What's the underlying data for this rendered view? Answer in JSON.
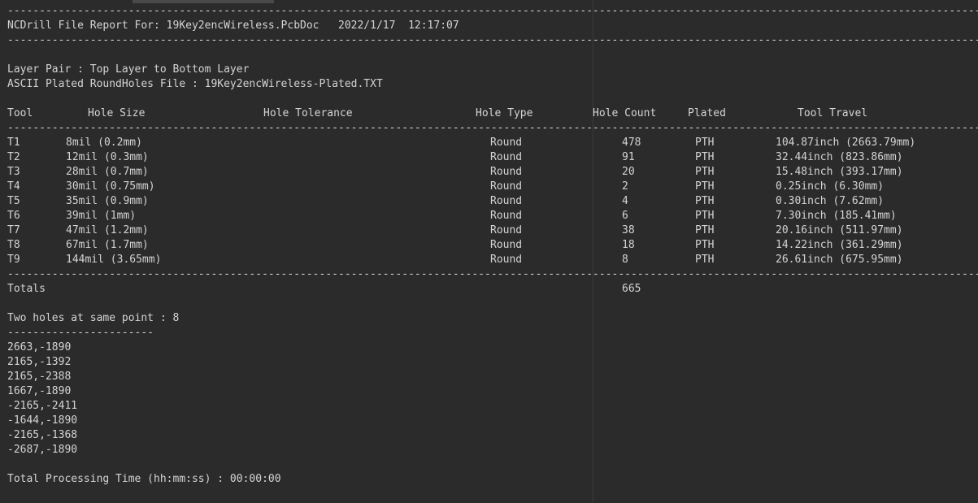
{
  "report": {
    "rule_long": "--------------------------------------------------------------------------------------------------------------------------------------------------------------------------------------",
    "header": "NCDrill File Report For: 19Key2encWireless.PcbDoc   2022/1/17  12:17:07",
    "layer_pair": "Layer Pair : Top Layer to Bottom Layer",
    "file_line": "ASCII Plated RoundHoles File : 19Key2encWireless-Plated.TXT",
    "columns": {
      "tool": "Tool",
      "hole_size": "Hole Size",
      "hole_tolerance": "Hole Tolerance",
      "hole_type": "Hole Type",
      "hole_count": "Hole Count",
      "plated": "Plated",
      "tool_travel": "Tool Travel"
    },
    "tools": [
      {
        "tool": "T1",
        "size": "8mil (0.2mm)",
        "type": "Round",
        "count": "478",
        "plated": "PTH",
        "travel": "104.87inch (2663.79mm)"
      },
      {
        "tool": "T2",
        "size": "12mil (0.3mm)",
        "type": "Round",
        "count": "91",
        "plated": "PTH",
        "travel": "32.44inch (823.86mm)"
      },
      {
        "tool": "T3",
        "size": "28mil (0.7mm)",
        "type": "Round",
        "count": "20",
        "plated": "PTH",
        "travel": "15.48inch (393.17mm)"
      },
      {
        "tool": "T4",
        "size": "30mil (0.75mm)",
        "type": "Round",
        "count": "2",
        "plated": "PTH",
        "travel": "0.25inch (6.30mm)"
      },
      {
        "tool": "T5",
        "size": "35mil (0.9mm)",
        "type": "Round",
        "count": "4",
        "plated": "PTH",
        "travel": "0.30inch (7.62mm)"
      },
      {
        "tool": "T6",
        "size": "39mil (1mm)",
        "type": "Round",
        "count": "6",
        "plated": "PTH",
        "travel": "7.30inch (185.41mm)"
      },
      {
        "tool": "T7",
        "size": "47mil (1.2mm)",
        "type": "Round",
        "count": "38",
        "plated": "PTH",
        "travel": "20.16inch (511.97mm)"
      },
      {
        "tool": "T8",
        "size": "67mil (1.7mm)",
        "type": "Round",
        "count": "18",
        "plated": "PTH",
        "travel": "14.22inch (361.29mm)"
      },
      {
        "tool": "T9",
        "size": "144mil (3.65mm)",
        "type": "Round",
        "count": "8",
        "plated": "PTH",
        "travel": "26.61inch (675.95mm)"
      }
    ],
    "totals_label": "Totals",
    "totals_count": "665",
    "same_point_label": "Two holes at same point : 8",
    "same_point_rule": "-----------------------",
    "points": [
      "2663,-1890",
      "2165,-1392",
      "2165,-2388",
      "1667,-1890",
      "-2165,-2411",
      "-1644,-1890",
      "-2165,-1368",
      "-2687,-1890"
    ],
    "processing_time": "Total Processing Time (hh:mm:ss) : 00:00:00"
  }
}
